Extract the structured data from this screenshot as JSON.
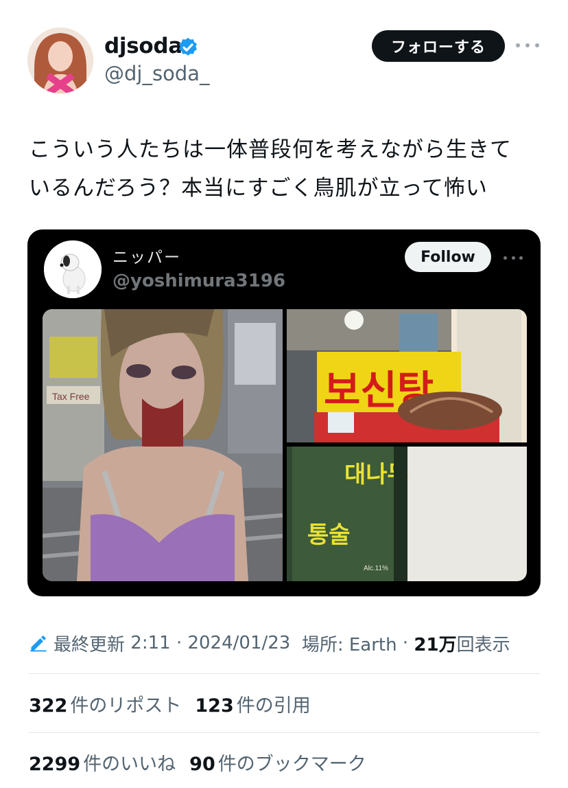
{
  "author": {
    "display_name": "djsoda",
    "handle": "@dj_soda_",
    "verified_icon": "verified-badge-icon",
    "follow_label": "フォローする"
  },
  "tweet": {
    "text_line1": "こういう人たちは一体普段何を考えながら生きて",
    "text_line2": "いるんだろう？本当にすごく鳥肌が立って怖い"
  },
  "quoted": {
    "display_name": "ニッパー",
    "handle": "@yoshimura3196",
    "follow_label": "Follow",
    "media": [
      {
        "icon": "photo-zombie-makeup",
        "signs": [
          "Tax Free"
        ]
      },
      {
        "icon": "photo-restaurant-sign",
        "signs": [
          "보신탕"
        ]
      },
      {
        "icon": "photo-bottle-label",
        "signs": [
          "대나무",
          "통술",
          "Alc.11%"
        ]
      }
    ]
  },
  "meta": {
    "edit_icon": "pencil-icon",
    "edited_label": "最終更新",
    "time": "2:11",
    "sep1": "·",
    "date": "2024/01/23",
    "location": "場所: Earth",
    "sep2": "·",
    "views_count": "21万",
    "views_label": "回表示"
  },
  "stats": {
    "reposts_count": "322",
    "reposts_label": "件のリポスト",
    "quotes_count": "123",
    "quotes_label": "件の引用",
    "likes_count": "2299",
    "likes_label": "件のいいね",
    "bookmarks_count": "90",
    "bookmarks_label": "件のブックマーク"
  },
  "colors": {
    "accent": "#1d9bf0",
    "text": "#0f1419",
    "secondary": "#536471",
    "card_bg": "#000000"
  }
}
